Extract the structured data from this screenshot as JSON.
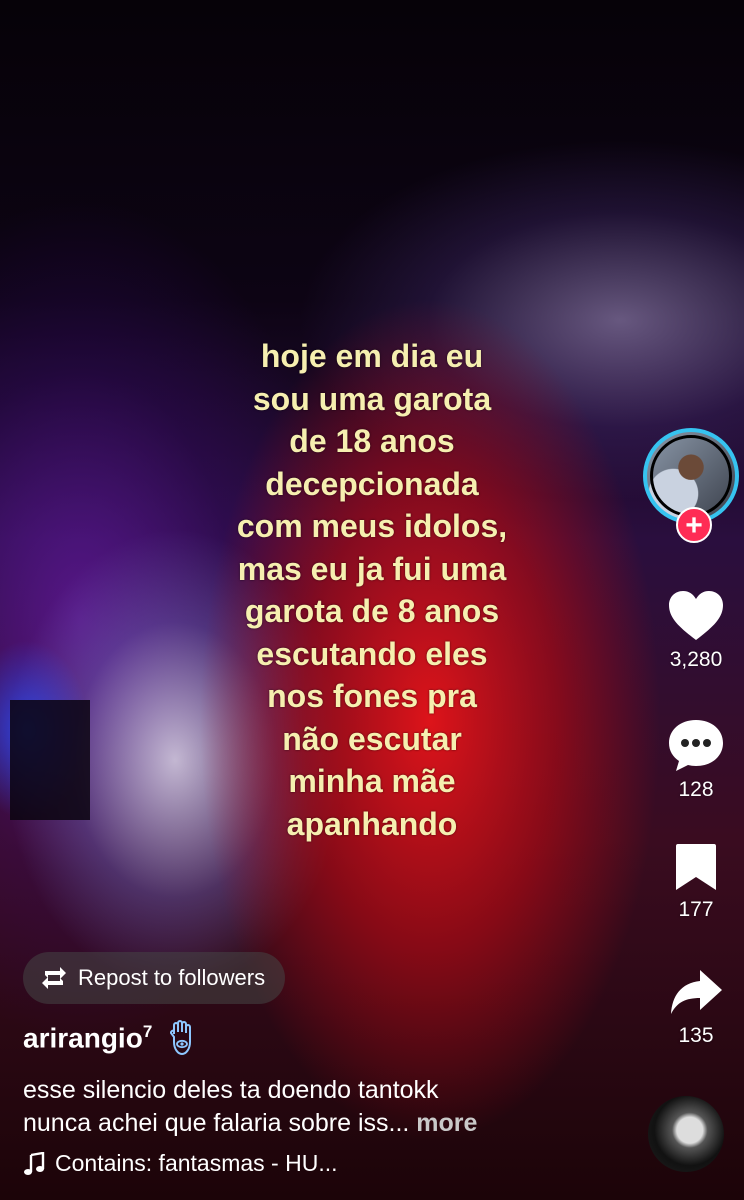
{
  "overlay_text_lines": [
    "hoje em dia eu",
    "sou uma garota",
    "de 18 anos",
    "decepcionada",
    "com meus idolos,",
    "mas eu ja fui uma",
    "garota de 8 anos",
    "escutando eles",
    "nos fones pra",
    "não escutar",
    "minha mãe",
    "apanhando"
  ],
  "actions": {
    "likes": "3,280",
    "comments": "128",
    "saves": "177",
    "shares": "135"
  },
  "follow_symbol": "+",
  "repost_label": "Repost to followers",
  "author": {
    "username": "arirangio",
    "superscript": "7"
  },
  "caption": {
    "line1": "esse silencio deles ta doendo tantokk",
    "line2": "nunca achei que falaria sobre iss...",
    "more": "more"
  },
  "music": {
    "text": "Contains: fantasmas - HU..."
  },
  "icons": [
    "heart-icon",
    "comment-icon",
    "bookmark-icon",
    "share-icon",
    "repost-icon",
    "music-note-icon",
    "hamsa-icon"
  ],
  "colors": {
    "overlay_text": "#f6efb0",
    "follow_plus": "#fe2c55",
    "avatar_ring": "#36c3f0"
  }
}
